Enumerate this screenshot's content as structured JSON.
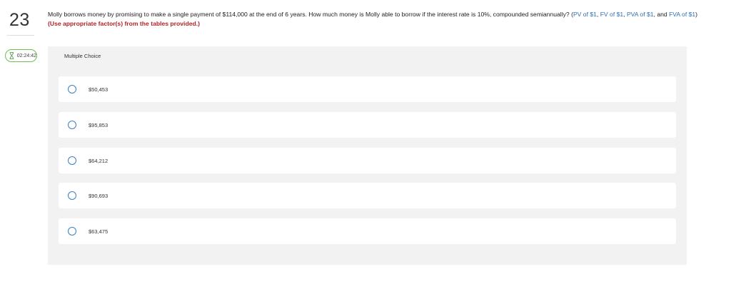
{
  "question_number": "23",
  "timer": {
    "value": "02:24:42",
    "icon": "hourglass-icon"
  },
  "question": {
    "text": "Molly borrows money by promising to make a single payment of $114,000 at the end of 6 years. How much money is Molly able to borrow if the interest rate is 10%, compounded semiannually? (",
    "links": [
      "PV of $1",
      "FV of $1",
      "PVA of $1",
      "FVA of $1"
    ],
    "sep1": ", ",
    "sep2": ", ",
    "sep3": ", and ",
    "tail": ")",
    "note": "(Use appropriate factor(s) from the tables provided.)"
  },
  "answer_panel": {
    "label": "Multiple Choice",
    "options": [
      "$50,453",
      "$95,853",
      "$64,212",
      "$90,693",
      "$63,475"
    ]
  },
  "colors": {
    "link": "#2f6fb5",
    "note": "#b0252a",
    "radio_border": "#3a7fc4",
    "timer_border": "#6fbf4f",
    "panel_bg": "#f2f2f2"
  }
}
